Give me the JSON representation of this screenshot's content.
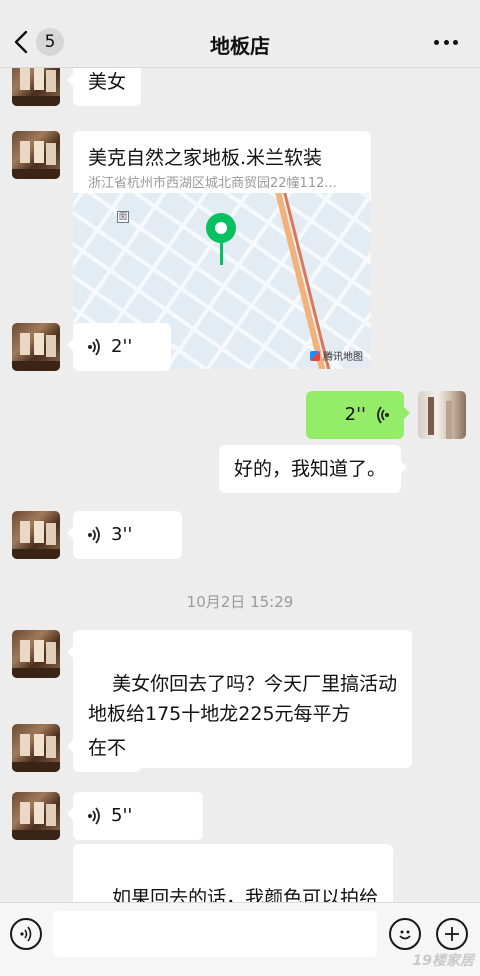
{
  "header": {
    "back_count": "5",
    "title": "地板店"
  },
  "messages": {
    "m1": {
      "text": "美女"
    },
    "location": {
      "title": "美克自然之家地板.米兰软装",
      "address": "浙江省杭州市西湖区城北商贸园22幢112...",
      "map_poi": "囡",
      "map_provider": "腾讯地图"
    },
    "v1": {
      "duration": "2''"
    },
    "v_me": {
      "duration": "2''"
    },
    "m_me": {
      "text": "好的，我知道了。"
    },
    "v2": {
      "duration": "3''"
    },
    "timestamp": "10月2日 15:29",
    "m2": {
      "text": "美女你回去了吗？今天厂里搞活动\n地板给175十地龙225元每平方"
    },
    "m3": {
      "text": "在不"
    },
    "v3": {
      "duration": "5''"
    },
    "m4": {
      "text": "如果回去的话，我颜色可以拍给\n你，手机上也可以下单的啊。"
    }
  },
  "footer": {
    "watermark": "19楼家居"
  },
  "colors": {
    "background": "#ededed",
    "bubble_self": "#95ec69",
    "bubble_other": "#ffffff",
    "pin": "#07c160"
  },
  "icons": [
    "back-chevron-icon",
    "more-dots-icon",
    "voice-wave-icon",
    "voice-toggle-icon",
    "emoji-icon",
    "plus-icon"
  ]
}
